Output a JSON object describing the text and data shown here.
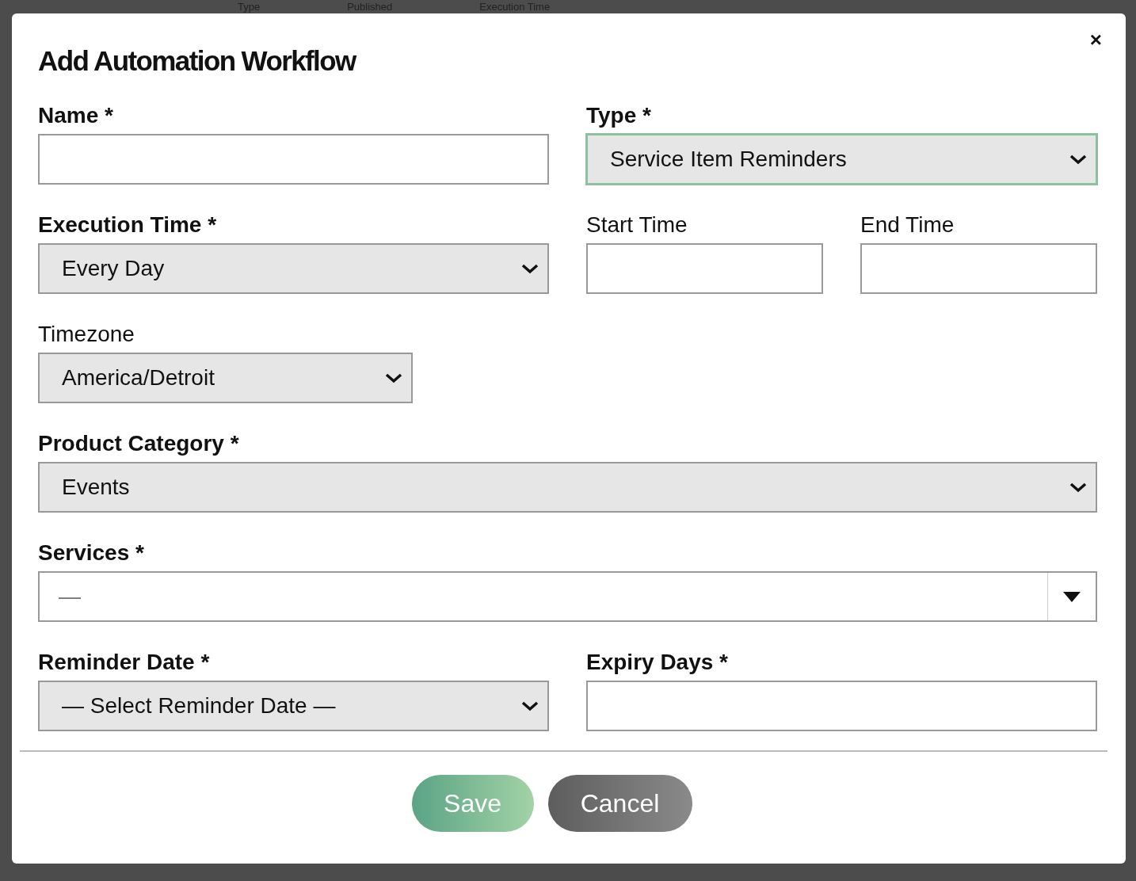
{
  "backdrop": {
    "columns": [
      "Type",
      "Published",
      "Execution Time"
    ]
  },
  "dialog": {
    "title": "Add Automation Workflow",
    "close": "×",
    "rows": [
      {
        "fields": [
          {
            "label": "Name *",
            "kind": "text",
            "focused": false
          },
          {
            "label": "Type *",
            "kind": "select",
            "value": "Service Item Reminders",
            "focused": true
          }
        ]
      },
      {
        "fields": [
          {
            "label": "Execution Time *",
            "kind": "select",
            "value": "Every Day",
            "focused": false
          },
          {
            "label": "Start Time",
            "kind": "text",
            "focused": false
          },
          {
            "label": "End Time",
            "kind": "text",
            "focused": false
          }
        ]
      },
      {
        "fields": [
          {
            "label": "Timezone",
            "kind": "select",
            "value": "America/Detroit",
            "focused": false
          }
        ]
      },
      {
        "fields": [
          {
            "label": "Product Category *",
            "kind": "select",
            "value": "Events",
            "focused": false
          }
        ]
      },
      {
        "fields": [
          {
            "label": "Services *",
            "kind": "combo",
            "placeholder": "—",
            "focused": false
          }
        ]
      },
      {
        "fields": [
          {
            "label": "Reminder Date *",
            "kind": "select",
            "value": "— Select Reminder Date —",
            "focused": false
          },
          {
            "label": "Expiry Days *",
            "kind": "text",
            "focused": false
          }
        ]
      }
    ],
    "buttons": [
      {
        "label": "Save",
        "kind": "primary"
      },
      {
        "label": "Cancel",
        "kind": "secondary"
      }
    ]
  }
}
